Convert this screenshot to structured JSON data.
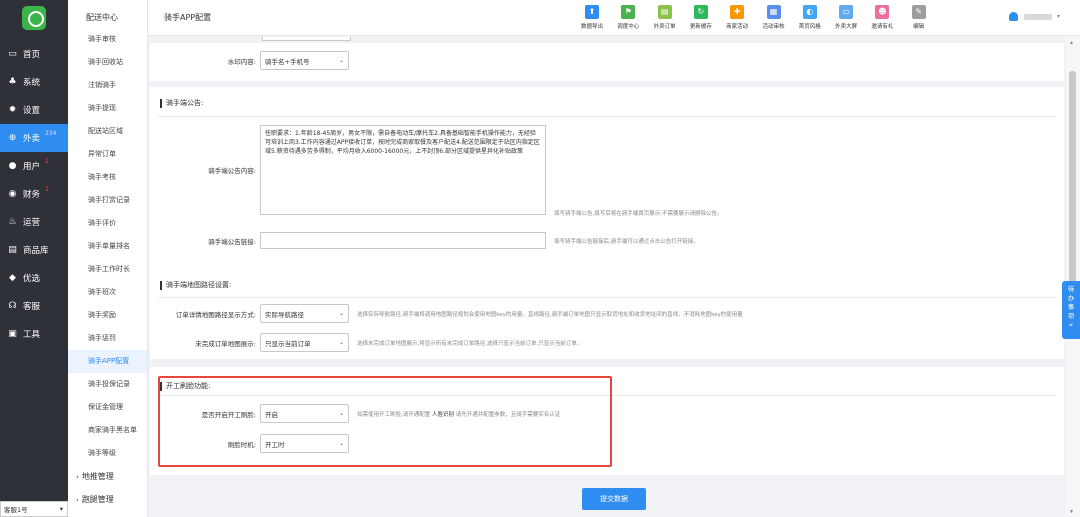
{
  "nav": {
    "items": [
      {
        "label": "首页",
        "icon": "monitor-icon"
      },
      {
        "label": "系统",
        "icon": "sitemap-icon"
      },
      {
        "label": "设置",
        "icon": "gear-icon"
      },
      {
        "label": "外卖",
        "icon": "cart-icon",
        "badge": "234",
        "active": true
      },
      {
        "label": "用户",
        "icon": "user-icon",
        "badge": "1"
      },
      {
        "label": "财务",
        "icon": "money-icon",
        "badge": "1"
      },
      {
        "label": "运营",
        "icon": "fire-icon"
      },
      {
        "label": "商品库",
        "icon": "list-icon"
      },
      {
        "label": "优选",
        "icon": "star-icon"
      },
      {
        "label": "客服",
        "icon": "headset-icon"
      },
      {
        "label": "工具",
        "icon": "toolbox-icon"
      }
    ],
    "store_select": "客服1号"
  },
  "subnav": {
    "title": "配送中心",
    "items": [
      "骑手审核",
      "骑手回收站",
      "注销骑手",
      "骑手提现",
      "配送站区域",
      "异常订单",
      "骑手考核",
      "骑手打赏记录",
      "骑手评价",
      "骑手单量排名",
      "骑手工作时长",
      "骑手班次",
      "骑手奖励",
      "骑手惩罚",
      "骑手APP配置",
      "骑手投保记录",
      "保证金管理",
      "商家骑手黑名单",
      "骑手等级"
    ],
    "active_index": 14,
    "groups": [
      "地推管理",
      "跑腿管理"
    ]
  },
  "header": {
    "title": "骑手APP配置",
    "tools": [
      {
        "label": "数据导出",
        "icon": "upload-icon",
        "color": "#2f8cf0"
      },
      {
        "label": "调度中心",
        "icon": "dispatch-icon",
        "color": "#4caf50"
      },
      {
        "label": "外卖订单",
        "icon": "order-icon",
        "color": "#8bc34a"
      },
      {
        "label": "更新缓存",
        "icon": "refresh-icon",
        "color": "#2eb85c"
      },
      {
        "label": "商家活动",
        "icon": "gift-icon",
        "color": "#ff9800"
      },
      {
        "label": "活动审核",
        "icon": "audit-icon",
        "color": "#5b8def"
      },
      {
        "label": "首页风格",
        "icon": "palette-icon",
        "color": "#42a5f5"
      },
      {
        "label": "外卖大屏",
        "icon": "screen-icon",
        "color": "#64a8f0"
      },
      {
        "label": "邀请有礼",
        "icon": "invite-icon",
        "color": "#ec6fa0"
      },
      {
        "label": "编辑",
        "icon": "pencil-icon",
        "color": "#9e9e9e"
      }
    ]
  },
  "form": {
    "watermark": {
      "label": "水印内容:",
      "value": "骑手名+手机号"
    },
    "notice_section": {
      "title": "骑手端公告:",
      "content_label": "骑手端公告内容:",
      "content": "任职要求：1.年龄18-45周岁，男女不限，需自备电动车/摩托车2.具备基础智能手机操作能力，无经验可培训上岗3.工作内容通过APP接收订单，按时完成商家取餐及客户配送4.配送范围限定于站区内指定区域5.薪资待遇多劳多得制，平均月收入6000-16000元，上不封顶6.部分区域提供星异化补贴政策",
      "content_hint": "填写骑手端公告,填写后将在骑手端首页展示,不需要展示请删除公告。",
      "link_label": "骑手端公告链接:",
      "link_value": "",
      "link_hint": "填写骑手端公告链接后,骑手端可以通过点击公告打开链接。"
    },
    "map_section": {
      "title": "骑手端地图路径设置:",
      "route_label": "订单详情地图路径显示方式:",
      "route_value": "实际导航路径",
      "route_hint": "选择实际导航路径,骑手端将调用地图路径规划会使用地图key的用量。直线路径,骑手端订单地图只显示取货地址和收货地址间的直线，不消耗地图key的使用量",
      "unfinished_label": "未完成订单地图展示:",
      "unfinished_value": "只显示当前订单",
      "unfinished_hint": "选择未完成订单地图展示,将显示所有未完成订单路径,选择只显示当前订单,只显示当前订单。"
    },
    "face_section": {
      "title": "开工刷脸功能:",
      "enable_label": "是否开启开工刷脸:",
      "enable_value": "开启",
      "enable_hint_pre": "如需使用开工刷脸,请开通配置",
      "enable_hint_link": "人脸识别",
      "enable_hint_post": "请先开通并配置参数，且骑手需要实名认证",
      "timing_label": "刷脸时机:",
      "timing_value": "开工时"
    },
    "submit_label": "提交数据"
  },
  "todo_tab": "待办事项",
  "colors": {
    "accent": "#2f8cf0",
    "highlight": "#e8453c",
    "nav_bg": "#2e3238"
  }
}
